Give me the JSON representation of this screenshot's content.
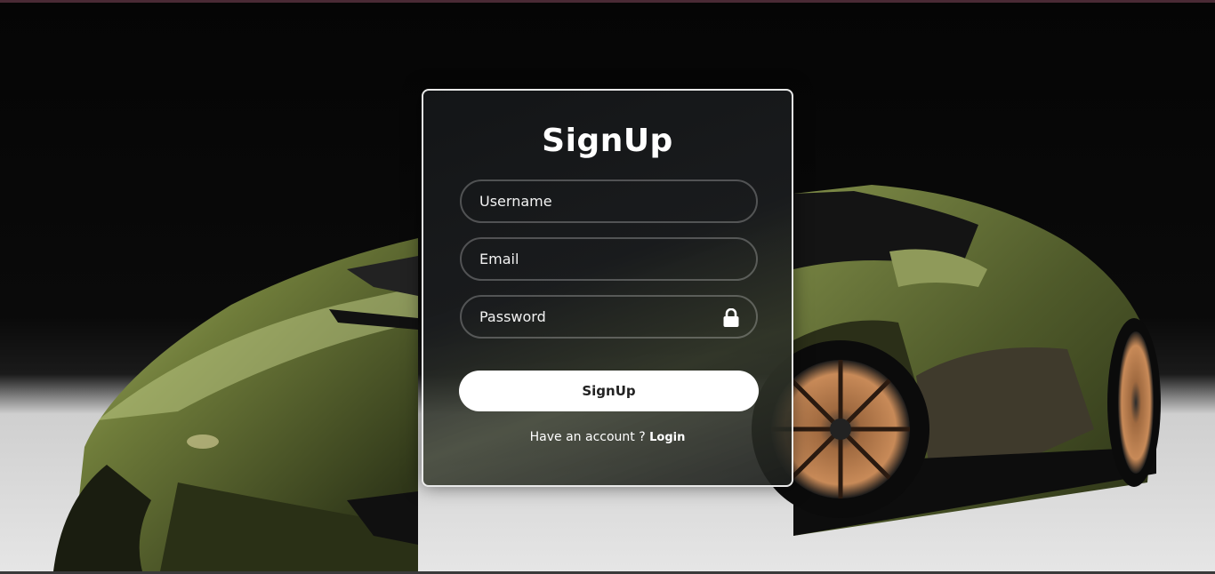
{
  "form": {
    "title": "SignUp",
    "username_placeholder": "Username",
    "email_placeholder": "Email",
    "password_placeholder": "Password",
    "lock_icon": "lock-icon",
    "submit_label": "SignUp",
    "footer_text": "Have an account ? ",
    "login_link": "Login"
  },
  "colors": {
    "card_border": "#ffffff",
    "button_bg": "#ffffff",
    "car_body": "#5e6b33",
    "wheel_rim": "#b87a4c"
  }
}
